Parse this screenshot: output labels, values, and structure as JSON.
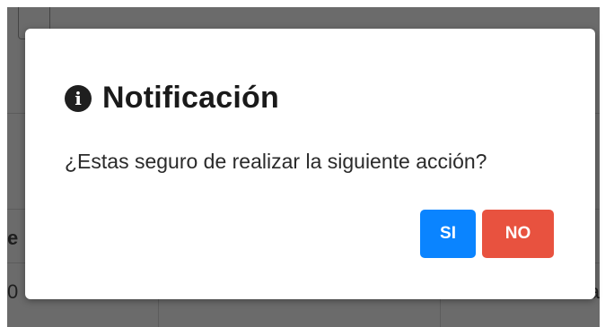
{
  "background": {
    "fragment_left_bold": "e",
    "fragment_left": "0",
    "fragment_right": "za"
  },
  "dialog": {
    "icon": "info-circle-icon",
    "icon_glyph": "i",
    "title": "Notificación",
    "message": "¿Estas seguro de realizar la siguiente acción?",
    "yes_label": "SI",
    "no_label": "NO",
    "colors": {
      "yes": "#0a84ff",
      "no": "#e8523f",
      "overlay": "#6b6b6b"
    }
  }
}
